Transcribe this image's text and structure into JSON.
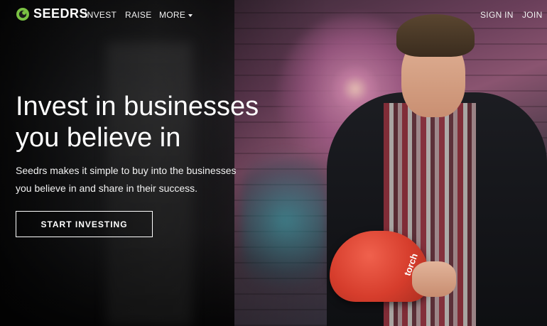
{
  "brand": {
    "name": "SEEDRS",
    "logo_icon": "seedrs-logo-icon",
    "accent": "#7ac143"
  },
  "nav": {
    "left": [
      {
        "label": "INVEST"
      },
      {
        "label": "RAISE"
      },
      {
        "label": "MORE"
      }
    ],
    "right": [
      {
        "label": "SIGN IN"
      },
      {
        "label": "JOIN"
      }
    ]
  },
  "hero": {
    "headline_line1": "Invest in businesses",
    "headline_line2": "you believe in",
    "subtext_line1": "Seedrs makes it simple to buy into the businesses",
    "subtext_line2": "you believe in and share in their success.",
    "cta_label": "START INVESTING",
    "helmet_text": "torch"
  }
}
